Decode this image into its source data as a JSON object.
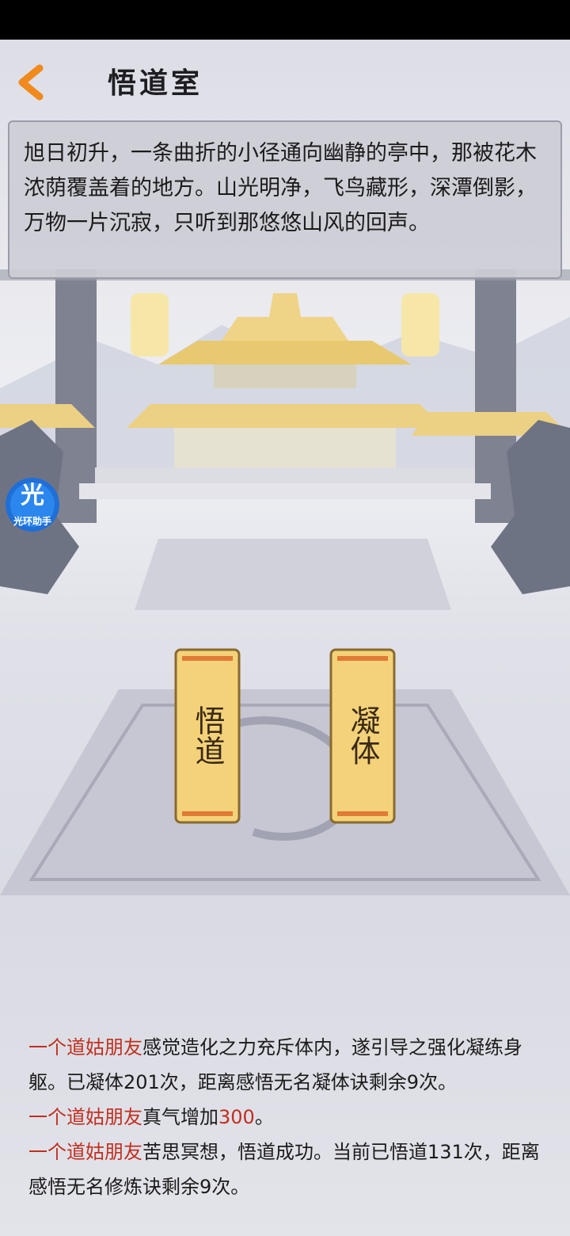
{
  "page": {
    "title": "悟道室"
  },
  "description": "旭日初升，一条曲折的小径通向幽静的亭中，那被花木浓荫覆盖着的地方。山光明净，飞鸟藏形，深潭倒影，万物一片沉寂，只听到那悠悠山风的回声。",
  "helper": {
    "glyph": "光",
    "label": "光环助手"
  },
  "actions": [
    {
      "label": "悟道"
    },
    {
      "label": "凝体"
    }
  ],
  "log": [
    {
      "name": "一个道姑朋友",
      "pre": "",
      "text": "感觉造化之力充斥体内，遂引导之强化凝练身躯。已凝体201次，距离感悟无名凝体诀剩余9次。",
      "value": "",
      "post": ""
    },
    {
      "name": "一个道姑朋友",
      "pre": "",
      "text": "真气增加",
      "value": "300",
      "post": "。"
    },
    {
      "name": "一个道姑朋友",
      "pre": "",
      "text": "苦思冥想，悟道成功。当前已悟道131次，距离感悟无名修炼诀剩余9次。",
      "value": "",
      "post": ""
    }
  ],
  "colors": {
    "accent": "#c0301f",
    "scroll": "#f3d27a",
    "back_arrow": "#f08a1c"
  }
}
